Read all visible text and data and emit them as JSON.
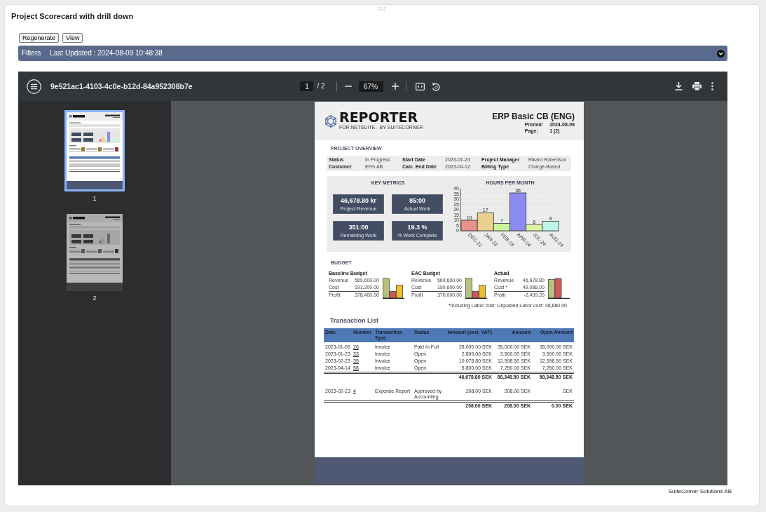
{
  "page": {
    "title": "Project Scorecard with drill down",
    "buttons": [
      "Regenerate",
      "View"
    ],
    "footer": "SuiteCorner Solutions AB"
  },
  "filters_bar": {
    "label": "Filters",
    "last_updated": "Last Updated : 2024-08-09 10:48:38",
    "expanded": false
  },
  "pdf_viewer": {
    "file_name": "9e521ac1-4103-4c0e-b12d-84a952308b7e",
    "page_input": "1",
    "page_of": "/ 2",
    "zoom": "67%",
    "thumbnails": [
      {
        "label": "1",
        "selected": true
      },
      {
        "label": "2",
        "selected": false
      }
    ],
    "document": {
      "wordmark": "REPORTER",
      "tagline": "FOR NETSUITE - BY SUITECORNER",
      "title": "ERP Basic CB (ENG)",
      "meta": [
        {
          "label": "Printed:",
          "value": "2024-08-09"
        },
        {
          "label": "Page:",
          "value": "1 (2)"
        }
      ],
      "project_overview": {
        "heading": "PROJECT OVERVIEW",
        "rows": [
          [
            {
              "label": "Status",
              "value": "In Progress"
            },
            {
              "label": "Start Date",
              "value": "2023-01-23"
            },
            {
              "label": "Project Manager",
              "value": "Rikard Robertson"
            }
          ],
          [
            {
              "label": "Customer",
              "value": "EFG AB"
            },
            {
              "label": "Calc. End Date",
              "value": "2023-04-12"
            },
            {
              "label": "Billing Type",
              "value": "Charge-Based"
            }
          ]
        ]
      },
      "key_metrics": {
        "heading": "KEY METRICS",
        "tiles": [
          {
            "value": "46,678.80 kr",
            "label": "Project Revenue"
          },
          {
            "value": "85:00",
            "label": "Actual Work"
          },
          {
            "value": "351:00",
            "label": "Remaining Work"
          },
          {
            "value": "19.3 %",
            "label": "% Work Complete"
          }
        ]
      },
      "hours_per_month": {
        "heading": "HOURS PER MONTH",
        "bars": [
          {
            "color": "#e8928a"
          },
          {
            "color": "#ead08e"
          },
          {
            "color": "#c9f59b"
          },
          {
            "color": "#8a8af0"
          },
          {
            "color": "#dcf5a0"
          },
          {
            "color": "#bdf7ea"
          }
        ],
        "chart_data": {
          "type": "bar",
          "categories": [
            "DEC-22",
            "JAN-23",
            "FEB-23",
            "APR-24",
            "JUL-24",
            "AUG-24"
          ],
          "series": [
            {
              "values": [
                10,
                17,
                7,
                36,
                6,
                9
              ]
            }
          ],
          "ylim": [
            0,
            40
          ],
          "yticks": [
            0,
            5,
            10,
            15,
            20,
            25,
            30,
            35,
            40
          ],
          "grid": true,
          "data_labels": true
        }
      },
      "budget": {
        "heading": "BUDGET",
        "groups": [
          {
            "title": "Baseline Budget",
            "rows": [
              {
                "label": "Revenue",
                "value": "569,600.00"
              },
              {
                "label": "Cost",
                "value": "191,200.00"
              },
              {
                "label": "Profit",
                "value": "378,400.00"
              }
            ]
          },
          {
            "title": "EAC Budget",
            "rows": [
              {
                "label": "Revenue",
                "value": "569,600.00"
              },
              {
                "label": "Cost",
                "value": "199,600.00"
              },
              {
                "label": "Profit",
                "value": "370,000.00"
              }
            ]
          },
          {
            "title": "Actual",
            "rows": [
              {
                "label": "Revenue",
                "value": "46,678.80"
              },
              {
                "label": "Cost *",
                "value": "49,088.00"
              },
              {
                "label": "Profit",
                "value": "-2,409.20"
              }
            ]
          }
        ],
        "footnote": "*Including Labor cost: Unposted Labor cost: 48,880.00"
      },
      "transactions": {
        "heading": "Transaction List",
        "columns": [
          "Date",
          "Number",
          "Transaction Type",
          "Status",
          "Amount (excl. VAT)",
          "Amount",
          "Open Amount"
        ],
        "groups": [
          {
            "rows": [
              [
                "2023-01-09",
                "26",
                "Invoice",
                "Paid In Full",
                "28,000.00 SEK",
                "35,000.00 SEK",
                "35,000.00 SEK"
              ],
              [
                "2023-01-23",
                "33",
                "Invoice",
                "Open",
                "2,800.00 SEK",
                "3,500.00 SEK",
                "3,500.00 SEK"
              ],
              [
                "2023-02-23",
                "35",
                "Invoice",
                "Open",
                "10,078.80 SEK",
                "12,598.50 SEK",
                "12,598.50 SEK"
              ],
              [
                "2023-04-14",
                "58",
                "Invoice",
                "Open",
                "5,800.00 SEK",
                "7,250.00 SEK",
                "7,250.00 SEK"
              ]
            ],
            "totals": [
              "46,678.80 SEK",
              "58,348.50 SEK",
              "58,348.50 SEK"
            ]
          },
          {
            "rows": [
              [
                "2023-02-23",
                "4",
                "Expense Report",
                "Approved by Accounting",
                "208.00 SEK",
                "208.00 SEK",
                "SEK"
              ]
            ],
            "totals": [
              "208.00 SEK",
              "208.00 SEK",
              "0.00 SEK"
            ]
          }
        ]
      }
    }
  }
}
